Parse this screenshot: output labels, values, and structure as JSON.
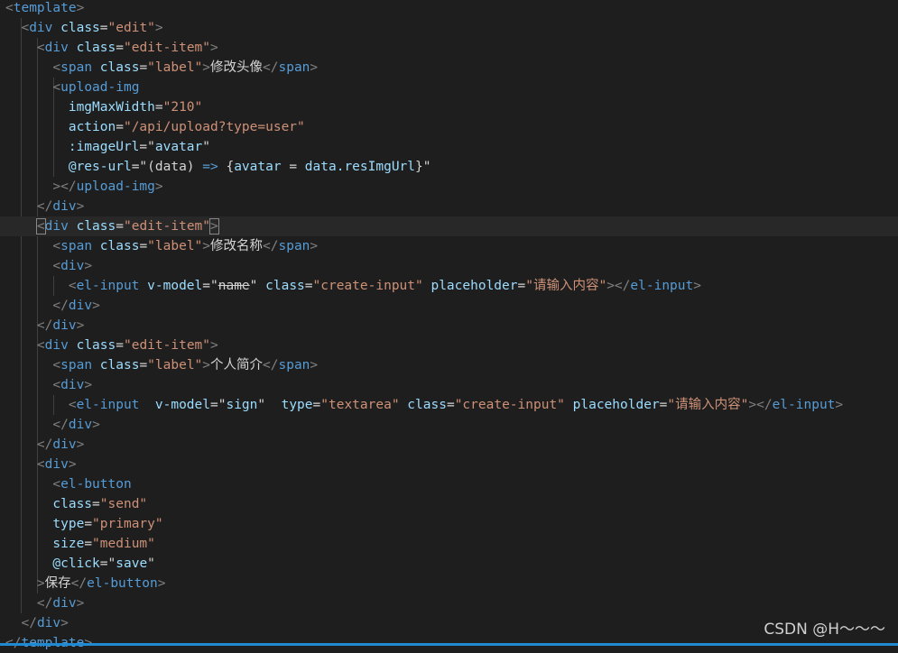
{
  "editor": {
    "language": "vue-html",
    "colors": {
      "background": "#1e1e1e",
      "tag": "#569cd6",
      "attribute": "#9cdcfe",
      "string": "#ce9178",
      "punctuation": "#808080",
      "text": "#d4d4d4"
    },
    "lines": [
      [
        [
          "p",
          "<"
        ],
        [
          "tag",
          "template"
        ],
        [
          "p",
          ">"
        ]
      ],
      [
        [
          "x",
          "  "
        ],
        [
          "p",
          "<"
        ],
        [
          "tag",
          "div"
        ],
        [
          "x",
          " "
        ],
        [
          "attr",
          "class"
        ],
        [
          "x",
          "="
        ],
        [
          "str",
          "\"edit\""
        ],
        [
          "p",
          ">"
        ]
      ],
      [
        [
          "x",
          "    "
        ],
        [
          "p",
          "<"
        ],
        [
          "tag",
          "div"
        ],
        [
          "x",
          " "
        ],
        [
          "attr",
          "class"
        ],
        [
          "x",
          "="
        ],
        [
          "str",
          "\"edit-item\""
        ],
        [
          "p",
          ">"
        ]
      ],
      [
        [
          "x",
          "      "
        ],
        [
          "p",
          "<"
        ],
        [
          "tag",
          "span"
        ],
        [
          "x",
          " "
        ],
        [
          "attr",
          "class"
        ],
        [
          "x",
          "="
        ],
        [
          "str",
          "\"label\""
        ],
        [
          "p",
          ">"
        ],
        [
          "x",
          "修改头像"
        ],
        [
          "p",
          "</"
        ],
        [
          "tag",
          "span"
        ],
        [
          "p",
          ">"
        ]
      ],
      [
        [
          "x",
          "      "
        ],
        [
          "p",
          "<"
        ],
        [
          "tag",
          "upload-img"
        ]
      ],
      [
        [
          "x",
          "        "
        ],
        [
          "attr",
          "imgMaxWidth"
        ],
        [
          "x",
          "="
        ],
        [
          "str",
          "\"210\""
        ]
      ],
      [
        [
          "x",
          "        "
        ],
        [
          "attr",
          "action"
        ],
        [
          "x",
          "="
        ],
        [
          "str",
          "\"/api/upload?type=user\""
        ]
      ],
      [
        [
          "x",
          "        "
        ],
        [
          "attr",
          ":imageUrl"
        ],
        [
          "x",
          "="
        ],
        [
          "x",
          "\""
        ],
        [
          "attr",
          "avatar"
        ],
        [
          "x",
          "\""
        ]
      ],
      [
        [
          "x",
          "        "
        ],
        [
          "attr",
          "@res-url"
        ],
        [
          "x",
          "=\"(data) "
        ],
        [
          "op",
          "=>"
        ],
        [
          "x",
          " {"
        ],
        [
          "attr",
          "avatar"
        ],
        [
          "x",
          " = "
        ],
        [
          "attr",
          "data.resImgUrl"
        ],
        [
          "x",
          "}\""
        ]
      ],
      [
        [
          "x",
          "      "
        ],
        [
          "p",
          "></"
        ],
        [
          "tag",
          "upload-img"
        ],
        [
          "p",
          ">"
        ]
      ],
      [
        [
          "x",
          "    "
        ],
        [
          "p",
          "</"
        ],
        [
          "tag",
          "div"
        ],
        [
          "p",
          ">"
        ]
      ],
      [
        [
          "x",
          "    "
        ],
        [
          "pbox",
          "<"
        ],
        [
          "tag",
          "div"
        ],
        [
          "x",
          " "
        ],
        [
          "attr",
          "class"
        ],
        [
          "x",
          "="
        ],
        [
          "str",
          "\"edit-item\""
        ],
        [
          "pbox",
          ">"
        ]
      ],
      [
        [
          "x",
          "      "
        ],
        [
          "p",
          "<"
        ],
        [
          "tag",
          "span"
        ],
        [
          "x",
          " "
        ],
        [
          "attr",
          "class"
        ],
        [
          "x",
          "="
        ],
        [
          "str",
          "\"label\""
        ],
        [
          "p",
          ">"
        ],
        [
          "x",
          "修改名称"
        ],
        [
          "p",
          "</"
        ],
        [
          "tag",
          "span"
        ],
        [
          "p",
          ">"
        ]
      ],
      [
        [
          "x",
          "      "
        ],
        [
          "p",
          "<"
        ],
        [
          "tag",
          "div"
        ],
        [
          "p",
          ">"
        ]
      ],
      [
        [
          "x",
          "        "
        ],
        [
          "p",
          "<"
        ],
        [
          "tag",
          "el-input"
        ],
        [
          "x",
          " "
        ],
        [
          "attr",
          "v-model"
        ],
        [
          "x",
          "=\""
        ],
        [
          "strike",
          "name"
        ],
        [
          "x",
          "\" "
        ],
        [
          "attr",
          "class"
        ],
        [
          "x",
          "="
        ],
        [
          "str",
          "\"create-input\""
        ],
        [
          "x",
          " "
        ],
        [
          "attr",
          "placeholder"
        ],
        [
          "x",
          "="
        ],
        [
          "str",
          "\"请输入内容\""
        ],
        [
          "p",
          "></"
        ],
        [
          "tag",
          "el-input"
        ],
        [
          "p",
          ">"
        ]
      ],
      [
        [
          "x",
          "      "
        ],
        [
          "p",
          "</"
        ],
        [
          "tag",
          "div"
        ],
        [
          "p",
          ">"
        ]
      ],
      [
        [
          "x",
          "    "
        ],
        [
          "p",
          "</"
        ],
        [
          "tag",
          "div"
        ],
        [
          "p",
          ">"
        ]
      ],
      [
        [
          "x",
          "    "
        ],
        [
          "p",
          "<"
        ],
        [
          "tag",
          "div"
        ],
        [
          "x",
          " "
        ],
        [
          "attr",
          "class"
        ],
        [
          "x",
          "="
        ],
        [
          "str",
          "\"edit-item\""
        ],
        [
          "p",
          ">"
        ]
      ],
      [
        [
          "x",
          "      "
        ],
        [
          "p",
          "<"
        ],
        [
          "tag",
          "span"
        ],
        [
          "x",
          " "
        ],
        [
          "attr",
          "class"
        ],
        [
          "x",
          "="
        ],
        [
          "str",
          "\"label\""
        ],
        [
          "p",
          ">"
        ],
        [
          "x",
          "个人简介"
        ],
        [
          "p",
          "</"
        ],
        [
          "tag",
          "span"
        ],
        [
          "p",
          ">"
        ]
      ],
      [
        [
          "x",
          "      "
        ],
        [
          "p",
          "<"
        ],
        [
          "tag",
          "div"
        ],
        [
          "p",
          ">"
        ]
      ],
      [
        [
          "x",
          "        "
        ],
        [
          "p",
          "<"
        ],
        [
          "tag",
          "el-input"
        ],
        [
          "x",
          "  "
        ],
        [
          "attr",
          "v-model"
        ],
        [
          "x",
          "=\""
        ],
        [
          "attr",
          "sign"
        ],
        [
          "x",
          "\"  "
        ],
        [
          "attr",
          "type"
        ],
        [
          "x",
          "="
        ],
        [
          "str",
          "\"textarea\""
        ],
        [
          "x",
          " "
        ],
        [
          "attr",
          "class"
        ],
        [
          "x",
          "="
        ],
        [
          "str",
          "\"create-input\""
        ],
        [
          "x",
          " "
        ],
        [
          "attr",
          "placeholder"
        ],
        [
          "x",
          "="
        ],
        [
          "str",
          "\"请输入内容\""
        ],
        [
          "p",
          "></"
        ],
        [
          "tag",
          "el-input"
        ],
        [
          "p",
          ">"
        ]
      ],
      [
        [
          "x",
          "      "
        ],
        [
          "p",
          "</"
        ],
        [
          "tag",
          "div"
        ],
        [
          "p",
          ">"
        ]
      ],
      [
        [
          "x",
          "    "
        ],
        [
          "p",
          "</"
        ],
        [
          "tag",
          "div"
        ],
        [
          "p",
          ">"
        ]
      ],
      [
        [
          "x",
          "    "
        ],
        [
          "p",
          "<"
        ],
        [
          "tag",
          "div"
        ],
        [
          "p",
          ">"
        ]
      ],
      [
        [
          "x",
          "      "
        ],
        [
          "p",
          "<"
        ],
        [
          "tag",
          "el-button"
        ]
      ],
      [
        [
          "x",
          "      "
        ],
        [
          "attr",
          "class"
        ],
        [
          "x",
          "="
        ],
        [
          "str",
          "\"send\""
        ]
      ],
      [
        [
          "x",
          "      "
        ],
        [
          "attr",
          "type"
        ],
        [
          "x",
          "="
        ],
        [
          "str",
          "\"primary\""
        ]
      ],
      [
        [
          "x",
          "      "
        ],
        [
          "attr",
          "size"
        ],
        [
          "x",
          "="
        ],
        [
          "str",
          "\"medium\""
        ]
      ],
      [
        [
          "x",
          "      "
        ],
        [
          "attr",
          "@click"
        ],
        [
          "x",
          "=\""
        ],
        [
          "attr",
          "save"
        ],
        [
          "x",
          "\""
        ]
      ],
      [
        [
          "x",
          "    "
        ],
        [
          "p",
          ">"
        ],
        [
          "x",
          "保存"
        ],
        [
          "p",
          "</"
        ],
        [
          "tag",
          "el-button"
        ],
        [
          "p",
          ">"
        ]
      ],
      [
        [
          "x",
          "    "
        ],
        [
          "p",
          "</"
        ],
        [
          "tag",
          "div"
        ],
        [
          "p",
          ">"
        ]
      ],
      [
        [
          "x",
          "  "
        ],
        [
          "p",
          "</"
        ],
        [
          "tag",
          "div"
        ],
        [
          "p",
          ">"
        ]
      ],
      [
        [
          "p",
          "</"
        ],
        [
          "tag",
          "template"
        ],
        [
          "p",
          ">"
        ]
      ]
    ]
  },
  "watermark": "CSDN @H～～～"
}
